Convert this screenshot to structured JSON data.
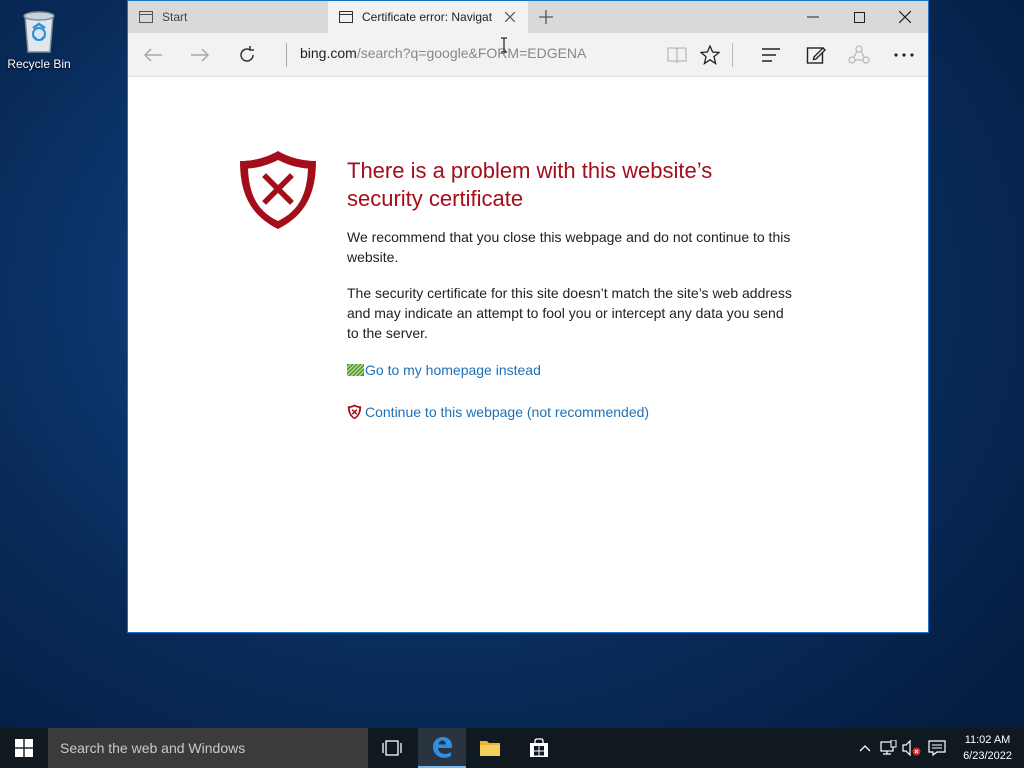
{
  "desktop": {
    "recycle_bin_label": "Recycle Bin"
  },
  "browser": {
    "tabs": [
      {
        "title": "Start",
        "active": false
      },
      {
        "title": "Certificate error: Navigat",
        "active": true
      }
    ],
    "address": {
      "host": "bing.com",
      "path": "/search?q=google&FORM=EDGENA"
    },
    "icons": {
      "back": "back-arrow-icon",
      "forward": "forward-arrow-icon",
      "refresh": "refresh-icon",
      "reading_view": "book-icon",
      "favorite": "star-icon",
      "hub": "hub-icon",
      "note": "pen-note-icon",
      "share": "share-icon",
      "more": "more-icon"
    }
  },
  "page": {
    "title": "There is a problem with this website’s security certificate",
    "paragraph1": "We recommend that you close this webpage and do not continue to this website.",
    "paragraph2": "The security certificate for this site doesn’t match the site’s web address and may indicate an attempt to fool you or intercept any data you send to the server.",
    "link_home": "Go to my homepage instead",
    "link_continue": "Continue to this webpage (not recommended)"
  },
  "taskbar": {
    "search_placeholder": "Search the web and Windows",
    "time": "11:02 AM",
    "date": "6/23/2022"
  },
  "colors": {
    "error_red": "#a30e1a",
    "link_blue": "#1f6fb5",
    "taskbar": "#101820",
    "window_border": "#1a73c9"
  }
}
